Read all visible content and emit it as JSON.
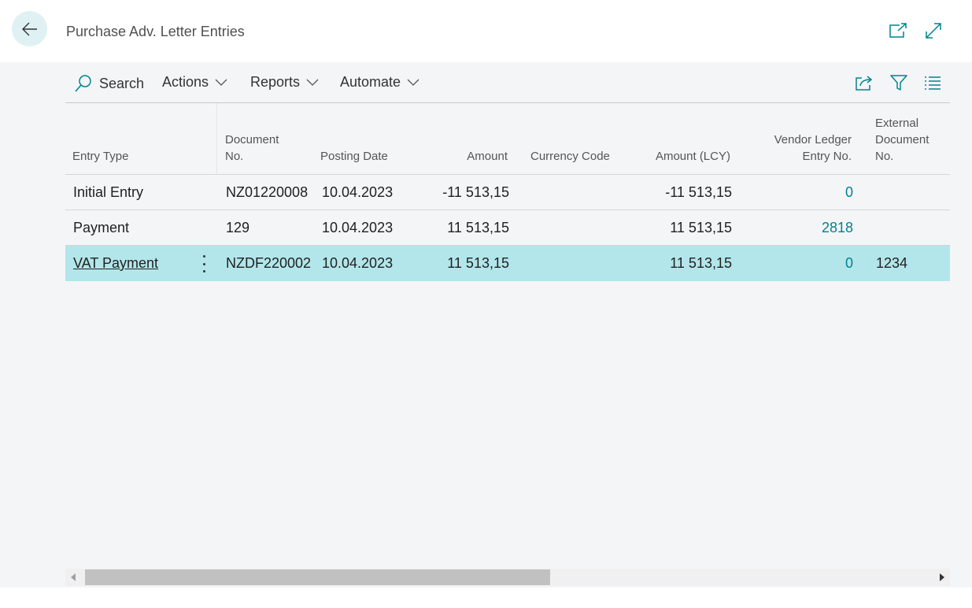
{
  "header": {
    "title": "Purchase Adv. Letter Entries",
    "back_icon": "arrow-left-icon",
    "open_new_window_icon": "open-in-new-window-icon",
    "expand_icon": "expand-icon"
  },
  "toolbar": {
    "search_label": "Search",
    "actions_label": "Actions",
    "reports_label": "Reports",
    "automate_label": "Automate",
    "share_icon": "share-icon",
    "filter_icon": "filter-icon",
    "list_icon": "list-view-icon"
  },
  "table": {
    "columns": {
      "entry_type": "Entry Type",
      "document_no_1": "Document",
      "document_no_2": "No.",
      "posting_date": "Posting Date",
      "amount": "Amount",
      "currency_code": "Currency Code",
      "amount_lcy": "Amount (LCY)",
      "vendor_ledger_1": "Vendor Ledger",
      "vendor_ledger_2": "Entry No.",
      "external_doc_1": "External",
      "external_doc_2": "Document",
      "external_doc_3": "No."
    },
    "rows": [
      {
        "entry_type": "Initial Entry",
        "document_no": "NZ01220008",
        "posting_date": "10.04.2023",
        "amount": "-11 513,15",
        "currency_code": "",
        "amount_lcy": "-11 513,15",
        "vendor_ledger_entry_no": "0",
        "external_document_no": ""
      },
      {
        "entry_type": "Payment",
        "document_no": "129",
        "posting_date": "10.04.2023",
        "amount": "11 513,15",
        "currency_code": "",
        "amount_lcy": "11 513,15",
        "vendor_ledger_entry_no": "2818",
        "external_document_no": ""
      },
      {
        "entry_type": "VAT Payment",
        "document_no": "NZDF220002",
        "posting_date": "10.04.2023",
        "amount": "11 513,15",
        "currency_code": "",
        "amount_lcy": "11 513,15",
        "vendor_ledger_entry_no": "0",
        "external_document_no": "1234"
      }
    ],
    "selected_row": 3
  },
  "colors": {
    "accent": "#00838f",
    "selected_row": "#b2e6ea",
    "back_button_bg": "#dff1f3"
  }
}
